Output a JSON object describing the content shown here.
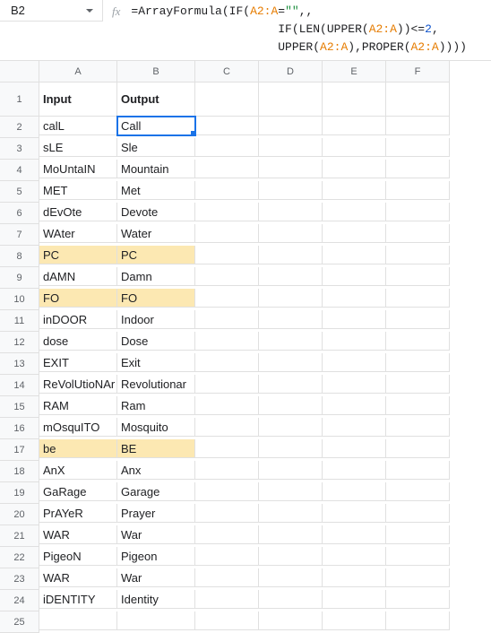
{
  "namebox": {
    "value": "B2"
  },
  "fx_label": "fx",
  "formula": {
    "plain": "=ArrayFormula(IF(A2:A=\"\",,\n                     IF(LEN(UPPER(A2:A))<=2,\n                     UPPER(A2:A),PROPER(A2:A))))",
    "indent1": "                     ",
    "indent2": "                     ",
    "parts": {
      "eq": "=",
      "af": "ArrayFormula",
      "if": "IF",
      "len": "LEN",
      "upper": "UPPER",
      "proper": "PROPER",
      "ref": "A2:A",
      "empty": "\"\"",
      "two": "2"
    }
  },
  "columns": [
    "A",
    "B",
    "C",
    "D",
    "E",
    "F"
  ],
  "headers": {
    "A": "Input",
    "B": "Output"
  },
  "selected_cell": "B2",
  "rows": [
    {
      "n": 1,
      "a": "Input",
      "b": "Output",
      "header": true
    },
    {
      "n": 2,
      "a": "calL",
      "b": "Call"
    },
    {
      "n": 3,
      "a": "sLE",
      "b": "Sle"
    },
    {
      "n": 4,
      "a": "MoUntaIN",
      "b": "Mountain"
    },
    {
      "n": 5,
      "a": "MET",
      "b": "Met"
    },
    {
      "n": 6,
      "a": "dEvOte",
      "b": "Devote"
    },
    {
      "n": 7,
      "a": "WAter",
      "b": "Water"
    },
    {
      "n": 8,
      "a": "PC",
      "b": "PC",
      "hl": true
    },
    {
      "n": 9,
      "a": "dAMN",
      "b": "Damn"
    },
    {
      "n": 10,
      "a": "FO",
      "b": "FO",
      "hl": true
    },
    {
      "n": 11,
      "a": "inDOOR",
      "b": "Indoor"
    },
    {
      "n": 12,
      "a": "dose",
      "b": "Dose"
    },
    {
      "n": 13,
      "a": "EXIT",
      "b": "Exit"
    },
    {
      "n": 14,
      "a": "ReVolUtioNAr",
      "b": "Revolutionar"
    },
    {
      "n": 15,
      "a": "RAM",
      "b": "Ram"
    },
    {
      "n": 16,
      "a": "mOsquITO",
      "b": "Mosquito"
    },
    {
      "n": 17,
      "a": "be",
      "b": "BE",
      "hl": true
    },
    {
      "n": 18,
      "a": "AnX",
      "b": "Anx"
    },
    {
      "n": 19,
      "a": "GaRage",
      "b": "Garage"
    },
    {
      "n": 20,
      "a": "PrAYeR",
      "b": "Prayer"
    },
    {
      "n": 21,
      "a": "WAR",
      "b": "War"
    },
    {
      "n": 22,
      "a": "PigeoN",
      "b": "Pigeon"
    },
    {
      "n": 23,
      "a": "WAR",
      "b": "War"
    },
    {
      "n": 24,
      "a": "iDENTITY",
      "b": "Identity"
    },
    {
      "n": 25,
      "a": "",
      "b": ""
    }
  ],
  "chart_data": {
    "type": "table",
    "title": "Input vs Output (ArrayFormula UPPER/PROPER)",
    "columns": [
      "Input",
      "Output"
    ],
    "rows": [
      [
        "calL",
        "Call"
      ],
      [
        "sLE",
        "Sle"
      ],
      [
        "MoUntaIN",
        "Mountain"
      ],
      [
        "MET",
        "Met"
      ],
      [
        "dEvOte",
        "Devote"
      ],
      [
        "WAter",
        "Water"
      ],
      [
        "PC",
        "PC"
      ],
      [
        "dAMN",
        "Damn"
      ],
      [
        "FO",
        "FO"
      ],
      [
        "inDOOR",
        "Indoor"
      ],
      [
        "dose",
        "Dose"
      ],
      [
        "EXIT",
        "Exit"
      ],
      [
        "ReVolUtioNAr",
        "Revolutionar"
      ],
      [
        "RAM",
        "Ram"
      ],
      [
        "mOsquITO",
        "Mosquito"
      ],
      [
        "be",
        "BE"
      ],
      [
        "AnX",
        "Anx"
      ],
      [
        "GaRage",
        "Garage"
      ],
      [
        "PrAYeR",
        "Prayer"
      ],
      [
        "WAR",
        "War"
      ],
      [
        "PigeoN",
        "Pigeon"
      ],
      [
        "WAR",
        "War"
      ],
      [
        "iDENTITY",
        "Identity"
      ]
    ]
  }
}
